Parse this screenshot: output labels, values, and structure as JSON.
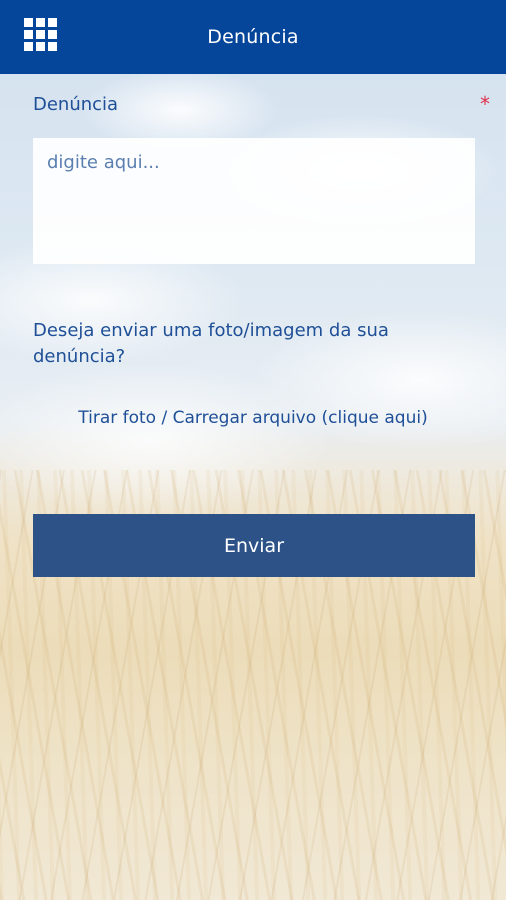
{
  "header": {
    "title": "Denúncia",
    "menu_icon": "grid-menu-icon",
    "background_color": "#05459a"
  },
  "form": {
    "field_label": "Denúncia",
    "required_mark": "*",
    "textarea_placeholder": "digite aqui...",
    "photo_question": "Deseja enviar uma foto/imagem da sua denúncia?",
    "upload_link": "Tirar foto / Carregar arquivo (clique aqui)",
    "submit_label": "Enviar"
  },
  "colors": {
    "accent_text": "#1e4f97",
    "button": "#2d5288",
    "required": "#e0314b"
  }
}
